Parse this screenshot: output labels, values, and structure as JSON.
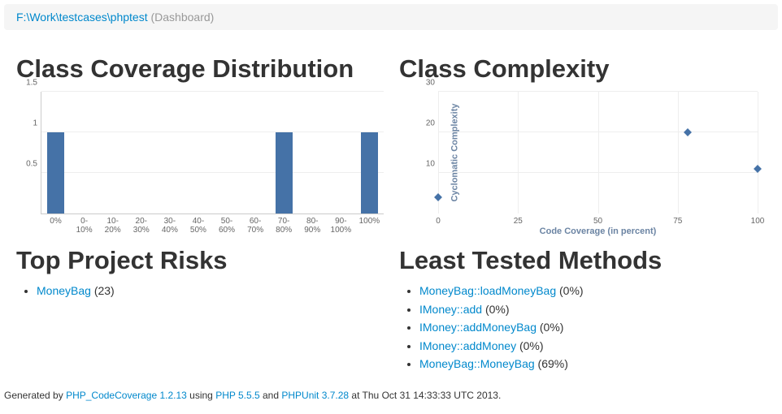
{
  "breadcrumb": {
    "path": "F:\\Work\\testcases\\phptest",
    "page": "(Dashboard)"
  },
  "headings": {
    "coverage_dist": "Class Coverage Distribution",
    "complexity": "Class Complexity",
    "risks": "Top Project Risks",
    "least_tested": "Least Tested Methods"
  },
  "chart_data": [
    {
      "type": "bar",
      "title": "Class Coverage Distribution",
      "categories": [
        "0%",
        "0-\n10%",
        "10-\n20%",
        "20-\n30%",
        "30-\n40%",
        "40-\n50%",
        "50-\n60%",
        "60-\n70%",
        "70-\n80%",
        "80-\n90%",
        "90-\n100%",
        "100%"
      ],
      "values": [
        1,
        0,
        0,
        0,
        0,
        0,
        0,
        0,
        1,
        0,
        0,
        1
      ],
      "ylim": [
        0,
        1.5
      ],
      "yticks": [
        0.5,
        1,
        1.5
      ]
    },
    {
      "type": "scatter",
      "title": "Class Complexity",
      "xlabel": "Code Coverage (in percent)",
      "ylabel": "Cyclomatic Complexity",
      "xlim": [
        0,
        100
      ],
      "ylim": [
        0,
        30
      ],
      "xticks": [
        0,
        25,
        50,
        75,
        100
      ],
      "yticks": [
        10,
        20,
        30
      ],
      "points": [
        {
          "x": 0,
          "y": 4
        },
        {
          "x": 78,
          "y": 20
        },
        {
          "x": 100,
          "y": 11
        }
      ]
    }
  ],
  "risks": [
    {
      "name": "MoneyBag",
      "score": "23"
    }
  ],
  "least_tested": [
    {
      "name": "MoneyBag::loadMoneyBag",
      "pct": "0%"
    },
    {
      "name": "IMoney::add",
      "pct": "0%"
    },
    {
      "name": "IMoney::addMoneyBag",
      "pct": "0%"
    },
    {
      "name": "IMoney::addMoney",
      "pct": "0%"
    },
    {
      "name": "MoneyBag::MoneyBag",
      "pct": "69%"
    }
  ],
  "footer": {
    "prefix": "Generated by ",
    "lib": "PHP_CodeCoverage 1.2.13",
    "using": " using ",
    "php": "PHP 5.5.5",
    "and": " and ",
    "phpunit": "PHPUnit 3.7.28",
    "at": " at Thu Oct 31 14:33:33 UTC 2013."
  }
}
